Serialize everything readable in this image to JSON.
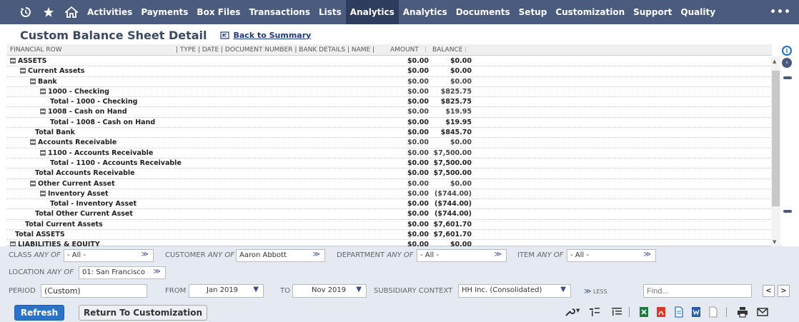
{
  "nav": {
    "items": [
      {
        "key": "activities",
        "label": "Activities"
      },
      {
        "key": "payments",
        "label": "Payments"
      },
      {
        "key": "box-files",
        "label": "Box Files"
      },
      {
        "key": "transactions",
        "label": "Transactions"
      },
      {
        "key": "lists",
        "label": "Lists"
      },
      {
        "key": "analytics",
        "label": "Analytics",
        "active": true
      },
      {
        "key": "analytics-2",
        "label": "Analytics"
      },
      {
        "key": "documents",
        "label": "Documents"
      },
      {
        "key": "setup",
        "label": "Setup"
      },
      {
        "key": "customization",
        "label": "Customization"
      },
      {
        "key": "support",
        "label": "Support"
      },
      {
        "key": "quality",
        "label": "Quality"
      }
    ],
    "more": "•••",
    "icons": [
      "recent-records-icon",
      "favorites-star-icon",
      "home-icon"
    ]
  },
  "title": {
    "page_title": "Custom Balance Sheet Detail",
    "back_link": "Back to Summary"
  },
  "report": {
    "columns": {
      "financial_row": "FINANCIAL ROW",
      "type_group": "| TYPE | DATE | DOCUMENT NUMBER | BANK DETAILS | NAME |",
      "amount": "AMOUNT",
      "balance": "BALANCE"
    },
    "rows": [
      {
        "label": "ASSETS",
        "indent": 0,
        "toggle": true,
        "bold": true,
        "amount": "$0.00",
        "balance": "$0.00"
      },
      {
        "label": "Current Assets",
        "indent": 1,
        "toggle": true,
        "bold": true,
        "amount": "$0.00",
        "balance": "$0.00"
      },
      {
        "label": "Bank",
        "indent": 2,
        "toggle": true,
        "bold": true,
        "amount": "$0.00",
        "balance": "$0.00",
        "normal_values": true
      },
      {
        "label": "1000 - Checking",
        "indent": 3,
        "toggle": true,
        "bold": true,
        "amount": "$0.00",
        "balance": "$825.75",
        "normal_values": true
      },
      {
        "label": "Total - 1000 - Checking",
        "indent": 4,
        "toggle": false,
        "bold": true,
        "amount": "$0.00",
        "balance": "$825.75"
      },
      {
        "label": "1008 - Cash on Hand",
        "indent": 3,
        "toggle": true,
        "bold": true,
        "amount": "$0.00",
        "balance": "$19.95",
        "normal_values": true
      },
      {
        "label": "Total - 1008 - Cash on Hand",
        "indent": 4,
        "toggle": false,
        "bold": true,
        "amount": "$0.00",
        "balance": "$19.95"
      },
      {
        "label": "Total Bank",
        "indent": 2.5,
        "toggle": false,
        "bold": true,
        "amount": "$0.00",
        "balance": "$845.70"
      },
      {
        "label": "Accounts Receivable",
        "indent": 2,
        "toggle": true,
        "bold": true,
        "amount": "$0.00",
        "balance": "$0.00",
        "normal_values": true
      },
      {
        "label": "1100 - Accounts Receivable",
        "indent": 3,
        "toggle": true,
        "bold": true,
        "amount": "$0.00",
        "balance": "$7,500.00",
        "normal_values": true
      },
      {
        "label": "Total - 1100 - Accounts Receivable",
        "indent": 4,
        "toggle": false,
        "bold": true,
        "amount": "$0.00",
        "balance": "$7,500.00"
      },
      {
        "label": "Total Accounts Receivable",
        "indent": 2.5,
        "toggle": false,
        "bold": true,
        "amount": "$0.00",
        "balance": "$7,500.00"
      },
      {
        "label": "Other Current Asset",
        "indent": 2,
        "toggle": true,
        "bold": true,
        "amount": "$0.00",
        "balance": "$0.00",
        "normal_values": true
      },
      {
        "label": "Inventory Asset",
        "indent": 3,
        "toggle": true,
        "bold": true,
        "amount": "$0.00",
        "balance": "($744.00)",
        "normal_values": true
      },
      {
        "label": "Total - Inventory Asset",
        "indent": 4,
        "toggle": false,
        "bold": true,
        "amount": "$0.00",
        "balance": "($744.00)"
      },
      {
        "label": "Total Other Current Asset",
        "indent": 2.5,
        "toggle": false,
        "bold": true,
        "amount": "$0.00",
        "balance": "($744.00)"
      },
      {
        "label": "Total Current Assets",
        "indent": 1.5,
        "toggle": false,
        "bold": true,
        "amount": "$0.00",
        "balance": "$7,601.70"
      },
      {
        "label": "Total ASSETS",
        "indent": 0.5,
        "toggle": false,
        "bold": true,
        "amount": "$0.00",
        "balance": "$7,601.70"
      },
      {
        "label": "LIABILITIES & EQUITY",
        "indent": 0,
        "toggle": true,
        "bold": true,
        "amount": "$0.00",
        "balance": "$0.00"
      }
    ]
  },
  "filters": {
    "class_label": "CLASS",
    "any_of": "ANY OF",
    "class_value": "- All -",
    "customer_label": "CUSTOMER",
    "customer_value": "Aaron Abbott",
    "department_label": "DEPARTMENT",
    "department_value": "- All -",
    "item_label": "ITEM",
    "item_value": "- All -",
    "location_label": "LOCATION",
    "location_value": "01: San Francisco",
    "period_label": "PERIOD",
    "period_value": "(Custom)",
    "from_label": "FROM",
    "from_value": "Jan 2019",
    "to_label": "TO",
    "to_value": "Nov 2019",
    "subsidiary_label": "SUBSIDIARY CONTEXT",
    "subsidiary_value": "HH Inc. (Consolidated)",
    "less_label": "LESS",
    "find_placeholder": "Find...",
    "prev": "<",
    "next": ">"
  },
  "actions": {
    "refresh": "Refresh",
    "return": "Return To Customization"
  }
}
